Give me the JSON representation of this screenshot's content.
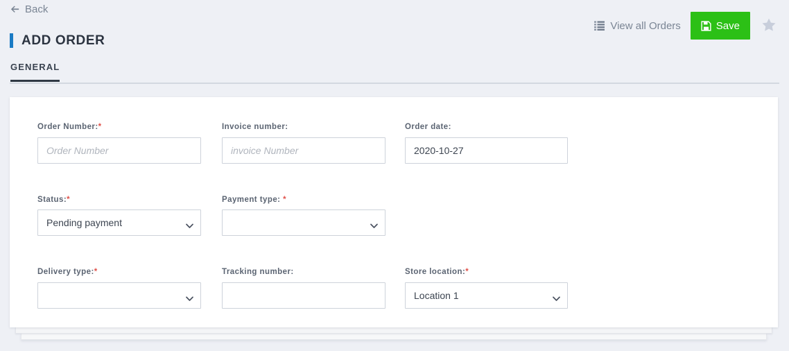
{
  "topbar": {
    "back_label": "Back",
    "back_icon": "arrow-left-icon",
    "view_all_label": "View all Orders",
    "view_all_icon": "list-icon",
    "save_label": "Save",
    "save_icon": "floppy-save-icon",
    "favorite_icon": "star-icon"
  },
  "header": {
    "title": "ADD ORDER",
    "accent_color": "#1a7bc4"
  },
  "tabs": [
    {
      "label": "GENERAL",
      "active": true
    }
  ],
  "colors": {
    "page_background": "#eef0f5",
    "save_green": "#2cc016",
    "required_red": "#e0524b",
    "tab_underline": "#2f3843"
  },
  "form": {
    "rows": [
      {
        "fields": [
          {
            "label": "Order Number:",
            "required": true,
            "required_mark": "*",
            "type": "text",
            "value": "",
            "placeholder": "Order Number"
          },
          {
            "label": "Invoice number:",
            "required": false,
            "required_mark": "",
            "type": "text",
            "value": "",
            "placeholder": "invoice Number"
          },
          {
            "label": "Order date:",
            "required": false,
            "required_mark": "",
            "type": "text",
            "value": "2020-10-27",
            "placeholder": ""
          }
        ]
      },
      {
        "fields": [
          {
            "label": "Status:",
            "required": true,
            "required_mark": "*",
            "type": "select",
            "value": "Pending payment",
            "options": [
              "Pending payment"
            ]
          },
          {
            "label": "Payment type: ",
            "required": true,
            "required_mark": "*",
            "type": "select",
            "value": "",
            "options": [
              ""
            ]
          }
        ]
      },
      {
        "fields": [
          {
            "label": "Delivery type:",
            "required": true,
            "required_mark": "*",
            "type": "select",
            "value": "",
            "options": [
              ""
            ]
          },
          {
            "label": "Tracking number:",
            "required": false,
            "required_mark": "",
            "type": "text",
            "value": "",
            "placeholder": ""
          },
          {
            "label": "Store location:",
            "required": true,
            "required_mark": "*",
            "type": "select",
            "value": "Location 1",
            "options": [
              "Location 1"
            ]
          }
        ]
      }
    ]
  }
}
